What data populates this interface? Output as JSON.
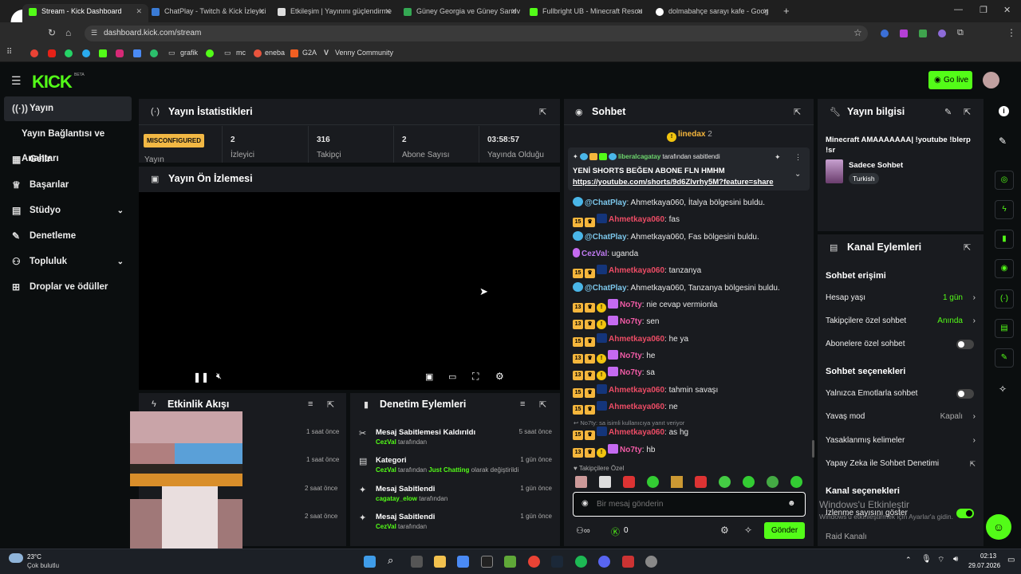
{
  "browser": {
    "tabs": [
      {
        "label": "Stream - Kick Dashboard",
        "active": true
      },
      {
        "label": "ChatPlay - Twitch & Kick İzleyici",
        "active": false
      },
      {
        "label": "Etkileşim | Yayınını güçlendirme",
        "active": false
      },
      {
        "label": "Güney Georgia ve Güney Sandv",
        "active": false
      },
      {
        "label": "Fullbright UB - Minecraft Resou",
        "active": false
      },
      {
        "label": "dolmabahçe sarayı kafe - Goog",
        "active": false
      }
    ],
    "new_tab": "+",
    "url": "dashboard.kick.com/stream",
    "bookmarks": [
      "grafik",
      "mc",
      "eneba",
      "G2A",
      "Venny Community"
    ]
  },
  "header": {
    "logo": "KICK",
    "beta": "BETA",
    "go_live": "Go live"
  },
  "sidebar": {
    "items": [
      {
        "label": "Yayın",
        "active": true
      },
      {
        "label": "Yayın Bağlantısı ve Anahtarı",
        "active": false
      },
      {
        "label": "Gelir",
        "active": false
      },
      {
        "label": "Başarılar",
        "active": false
      },
      {
        "label": "Stüdyo",
        "active": false
      },
      {
        "label": "Denetleme",
        "active": false
      },
      {
        "label": "Topluluk",
        "active": false
      },
      {
        "label": "Droplar ve ödüller",
        "active": false
      }
    ]
  },
  "stats": {
    "title": "Yayın İstatistikleri",
    "status_badge": "MISCONFIGURED",
    "status_label": "Yayın",
    "items": [
      {
        "value": "2",
        "label": "İzleyici"
      },
      {
        "value": "316",
        "label": "Takipçi"
      },
      {
        "value": "2",
        "label": "Abone Sayısı"
      },
      {
        "value": "03:58:57",
        "label": "Yayında Olduğu"
      }
    ]
  },
  "preview": {
    "title": "Yayın Ön İzlemesi"
  },
  "activity": {
    "title": "Etkinlik Akışı",
    "times": [
      "1 saat önce",
      "1 saat önce",
      "2 saat önce",
      "2 saat önce"
    ]
  },
  "moderation": {
    "title": "Denetim Eylemleri",
    "items": [
      {
        "title": "Mesaj Sabitlemesi Kaldırıldı",
        "user": "CezVal",
        "rest": "tarafından",
        "time": "5 saat önce"
      },
      {
        "title": "Kategori",
        "user": "CezVal",
        "rest": "tarafından",
        "cat": "Just Chatting",
        "rest2": "olarak değiştirildi",
        "time": "1 gün önce"
      },
      {
        "title": "Mesaj Sabitlendi",
        "user": "cagatay_elow",
        "rest": "tarafından",
        "time": "1 gün önce"
      },
      {
        "title": "Mesaj Sabitlendi",
        "user": "CezVal",
        "rest": "tarafından",
        "time": "1 gün önce"
      }
    ]
  },
  "chat": {
    "title": "Sohbet",
    "top_user": "linedax",
    "top_count": "2",
    "pinned_by": "liberalcagatay",
    "pinned_suffix": "tarafından sabitlendi",
    "pinned_text": "YENİ SHORTS BEĞEN ABONE FLN HMHM",
    "pinned_link": "https://youtube.com/shorts/9d6ZIvrhy5M?feature=share",
    "messages": [
      {
        "user": "@ChatPlay",
        "text": ": Ahmetkaya060, İtalya bölgesini buldu."
      },
      {
        "user": "Ahmetkaya060",
        "text": ": fas"
      },
      {
        "user": "@ChatPlay",
        "text": ": Ahmetkaya060, Fas bölgesini buldu."
      },
      {
        "user": "CezVal",
        "text": ": uganda"
      },
      {
        "user": "Ahmetkaya060",
        "text": ": tanzanya"
      },
      {
        "user": "@ChatPlay",
        "text": ": Ahmetkaya060, Tanzanya bölgesini buldu."
      },
      {
        "user": "No7ty",
        "text": ": nie cevap vermionla"
      },
      {
        "user": "No7ty",
        "text": ": sen"
      },
      {
        "user": "Ahmetkaya060",
        "text": ": he ya"
      },
      {
        "user": "No7ty",
        "text": ": he"
      },
      {
        "user": "No7ty",
        "text": ": sa"
      },
      {
        "user": "Ahmetkaya060",
        "text": ": tahmin savaşı"
      },
      {
        "user": "Ahmetkaya060",
        "text": ": ne"
      },
      {
        "user": "Ahmetkaya060",
        "text": ": as hg"
      },
      {
        "user": "No7ty",
        "text": ": hb"
      }
    ],
    "reply_note": "No7ty: sa isimli kullanıcıya yanıt veriyor",
    "followers_only": "Takipçilere Özel",
    "input_placeholder": "Bir mesaj gönderin",
    "points": "0",
    "send": "Gönder"
  },
  "stream_info": {
    "title": "Yayın bilgisi",
    "stream_title": "Minecraft AMAAAAAAA| !youtube !blerp !sr",
    "category": "Sadece Sohbet",
    "tag": "Turkish"
  },
  "channel": {
    "title": "Kanal Eylemleri",
    "chat_access": "Sohbet erişimi",
    "account_age": "Hesap yaşı",
    "account_age_val": "1 gün",
    "followers_chat": "Takipçilere özel sohbet",
    "followers_chat_val": "Anında",
    "subs_chat": "Abonelere özel sohbet",
    "chat_options": "Sohbet seçenekleri",
    "emotes_only": "Yalnızca Emotlarla sohbet",
    "slow_mode": "Yavaş mod",
    "slow_mode_val": "Kapalı",
    "banned_words": "Yasaklanmış kelimeler",
    "ai_mod": "Yapay Zeka ile Sohbet Denetimi",
    "channel_options": "Kanal seçenekleri",
    "show_viewers": "İzlenme sayısını göster",
    "raid": "Raid Kanalı"
  },
  "windows": {
    "activate": "Windows'u Etkinleştir",
    "activate_sub": "Windows'u etkinleştirmek için Ayarlar'a gidin."
  },
  "taskbar": {
    "temp": "23°C",
    "weather": "Çok bulutlu",
    "time": "02:13",
    "date": "29.07.2026"
  }
}
